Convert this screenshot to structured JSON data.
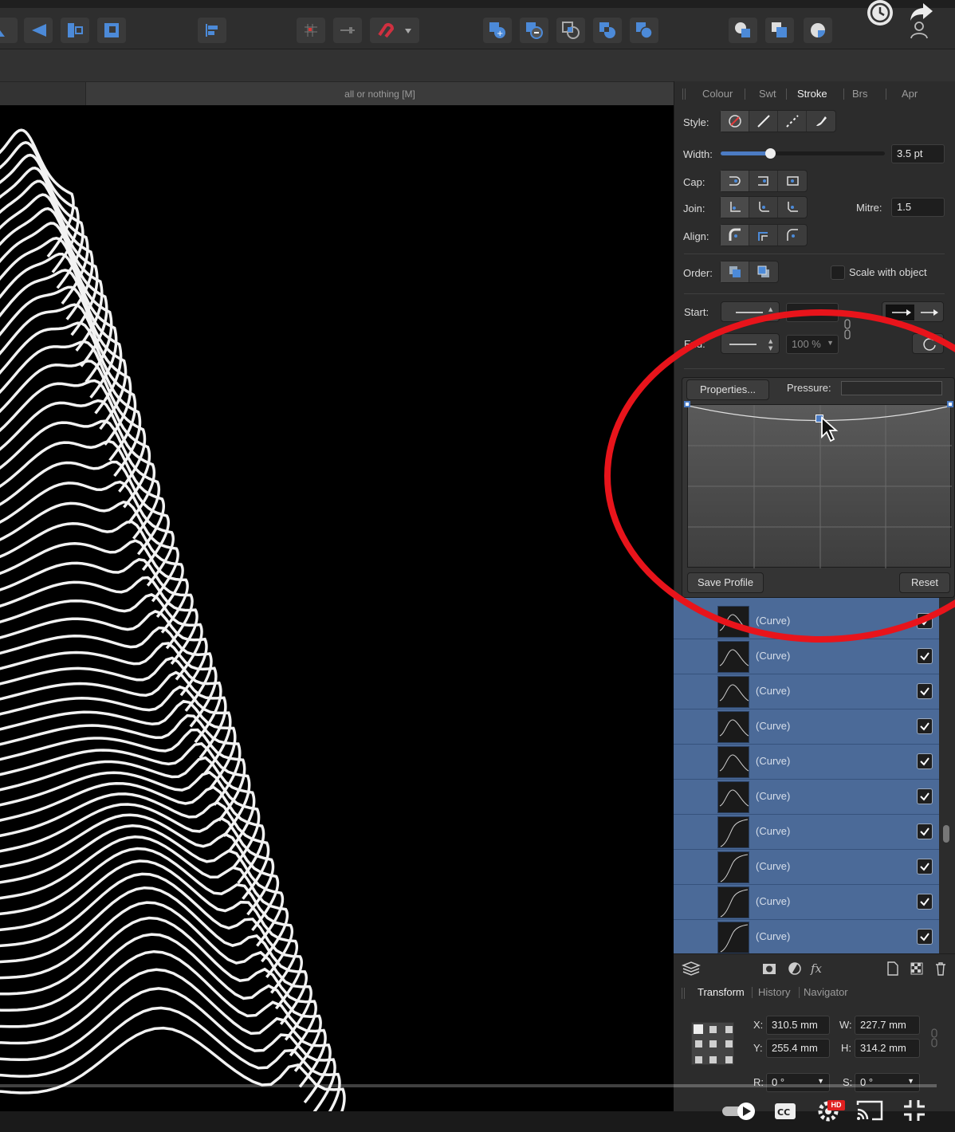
{
  "document": {
    "title": "all or nothing [M]"
  },
  "panel": {
    "tabs": [
      {
        "label": "Colour",
        "active": false
      },
      {
        "label": "Swt",
        "active": false
      },
      {
        "label": "Stroke",
        "active": true
      },
      {
        "label": "Brs",
        "active": false
      },
      {
        "label": "Apr",
        "active": false
      }
    ],
    "style_label": "Style:",
    "width_label": "Width:",
    "width_value": "3.5 pt",
    "width_fraction": 0.3,
    "cap_label": "Cap:",
    "join_label": "Join:",
    "mitre_label": "Mitre:",
    "mitre_value": "1.5",
    "align_label": "Align:",
    "order_label": "Order:",
    "scale_with_object_label": "Scale with object",
    "scale_with_object_checked": false,
    "start_label": "Start:",
    "end_label": "End:",
    "end_percent": "100 %",
    "properties_button": "Properties...",
    "pressure_label": "Pressure:",
    "save_profile_button": "Save Profile",
    "reset_button": "Reset"
  },
  "layers": {
    "items": [
      {
        "name": "(Curve)",
        "visible": true,
        "thumb": "bump"
      },
      {
        "name": "(Curve)",
        "visible": true,
        "thumb": "bump"
      },
      {
        "name": "(Curve)",
        "visible": true,
        "thumb": "bump"
      },
      {
        "name": "(Curve)",
        "visible": true,
        "thumb": "bump"
      },
      {
        "name": "(Curve)",
        "visible": true,
        "thumb": "bump"
      },
      {
        "name": "(Curve)",
        "visible": true,
        "thumb": "bump"
      },
      {
        "name": "(Curve)",
        "visible": true,
        "thumb": "rise"
      },
      {
        "name": "(Curve)",
        "visible": true,
        "thumb": "rise"
      },
      {
        "name": "(Curve)",
        "visible": true,
        "thumb": "rise"
      },
      {
        "name": "(Curve)",
        "visible": true,
        "thumb": "rise"
      }
    ]
  },
  "transform": {
    "tabs": [
      {
        "label": "Transform",
        "active": true
      },
      {
        "label": "History",
        "active": false
      },
      {
        "label": "Navigator",
        "active": false
      }
    ],
    "x_label": "X:",
    "x_value": "310.5 mm",
    "y_label": "Y:",
    "y_value": "255.4 mm",
    "w_label": "W:",
    "w_value": "227.7 mm",
    "h_label": "H:",
    "h_value": "314.2 mm",
    "r_label": "R:",
    "r_value": "0 °",
    "s_label": "S:",
    "s_value": "0 °"
  },
  "video": {
    "hd_badge": "HD"
  },
  "colors": {
    "accent": "#4c7cc4",
    "layer_selected": "#4b6a98",
    "annotation": "#e8141b"
  }
}
